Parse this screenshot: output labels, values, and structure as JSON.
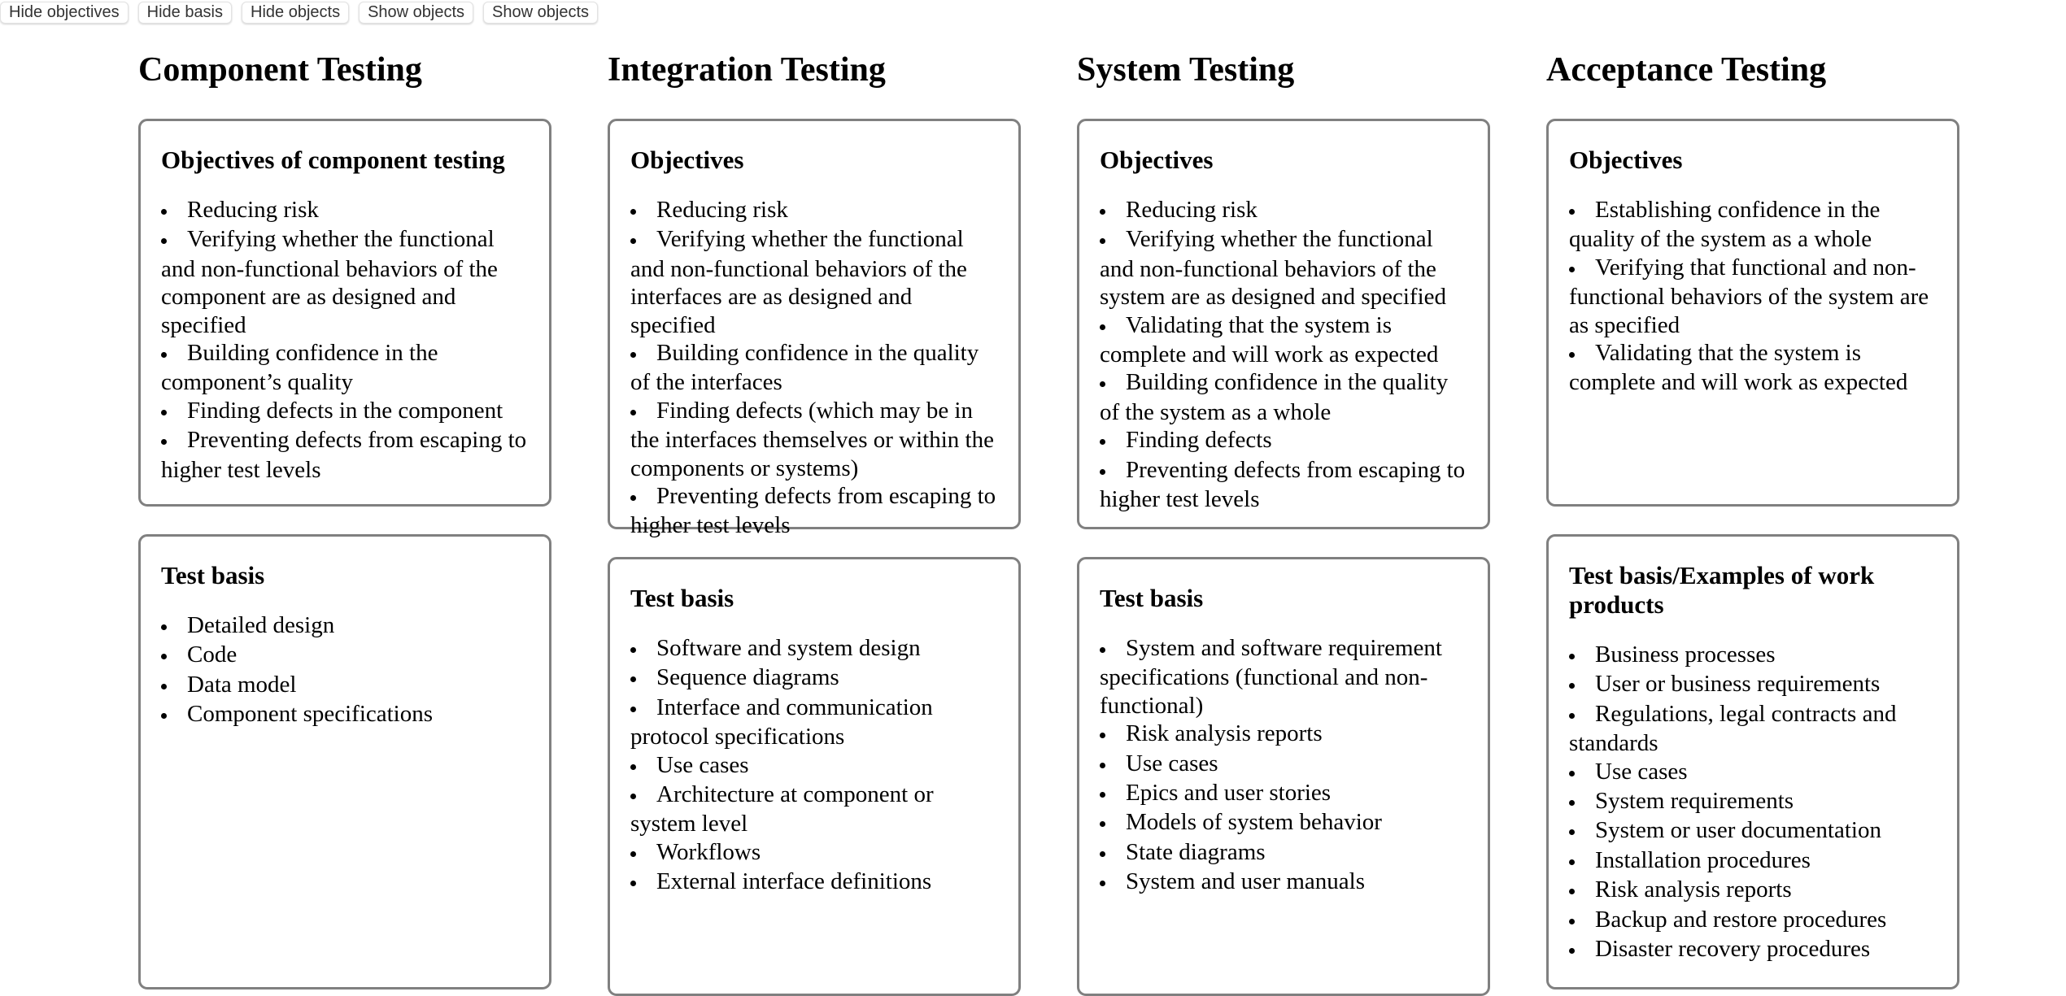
{
  "toolbar": {
    "buttons": [
      "Hide objectives",
      "Hide basis",
      "Hide objects",
      "Show objects",
      "Show objects"
    ]
  },
  "columns": [
    {
      "title": "Component Testing",
      "objectives": {
        "heading": "Objectives of component testing",
        "items": [
          "Reducing risk",
          "Verifying whether the functional and non-functional behaviors of the component are as designed and specified",
          "Building confidence in the component’s quality",
          "Finding defects in the component",
          "Preventing defects from escaping to higher test levels"
        ]
      },
      "basis": {
        "heading": "Test basis",
        "items": [
          "Detailed design",
          "Code",
          "Data model",
          "Component specifications"
        ]
      }
    },
    {
      "title": "Integration Testing",
      "objectives": {
        "heading": "Objectives",
        "items": [
          "Reducing risk",
          "Verifying whether the functional and non-functional behaviors of the interfaces are as designed and specified",
          "Building confidence in the quality of the interfaces",
          "Finding defects (which may be in the interfaces themselves or within the components or systems)",
          "Preventing defects from escaping to higher test levels"
        ]
      },
      "basis": {
        "heading": "Test basis",
        "items": [
          "Software and system design",
          "Sequence diagrams",
          "Interface and communication protocol specifications",
          "Use cases",
          "Architecture at component or system level",
          "Workflows",
          "External interface definitions"
        ]
      }
    },
    {
      "title": "System Testing",
      "objectives": {
        "heading": "Objectives",
        "items": [
          "Reducing risk",
          "Verifying whether the functional and non-functional behaviors of the system are as designed and specified",
          "Validating that the system is complete and will work as expected",
          "Building confidence in the quality of the system as a whole",
          "Finding defects",
          "Preventing defects from escaping to higher test levels"
        ]
      },
      "basis": {
        "heading": "Test basis",
        "items": [
          "System and software requirement specifications (functional and non-functional)",
          "Risk analysis reports",
          "Use cases",
          "Epics and user stories",
          "Models of system behavior",
          "State diagrams",
          "System and user manuals"
        ]
      }
    },
    {
      "title": "Acceptance Testing",
      "objectives": {
        "heading": "Objectives",
        "items": [
          "Establishing confidence in the quality of the system as a whole",
          "Verifying that functional and non-functional behaviors of the system are as specified",
          "Validating that the system is complete and will work as expected"
        ]
      },
      "basis": {
        "heading": "Test basis/Examples of work products",
        "items": [
          "Business processes",
          "User or business requirements",
          "Regulations, legal contracts and standards",
          "Use cases",
          "System requirements",
          "System or user documentation",
          "Installation procedures",
          "Risk analysis reports",
          "Backup and restore procedures",
          "Disaster recovery procedures"
        ]
      }
    }
  ]
}
